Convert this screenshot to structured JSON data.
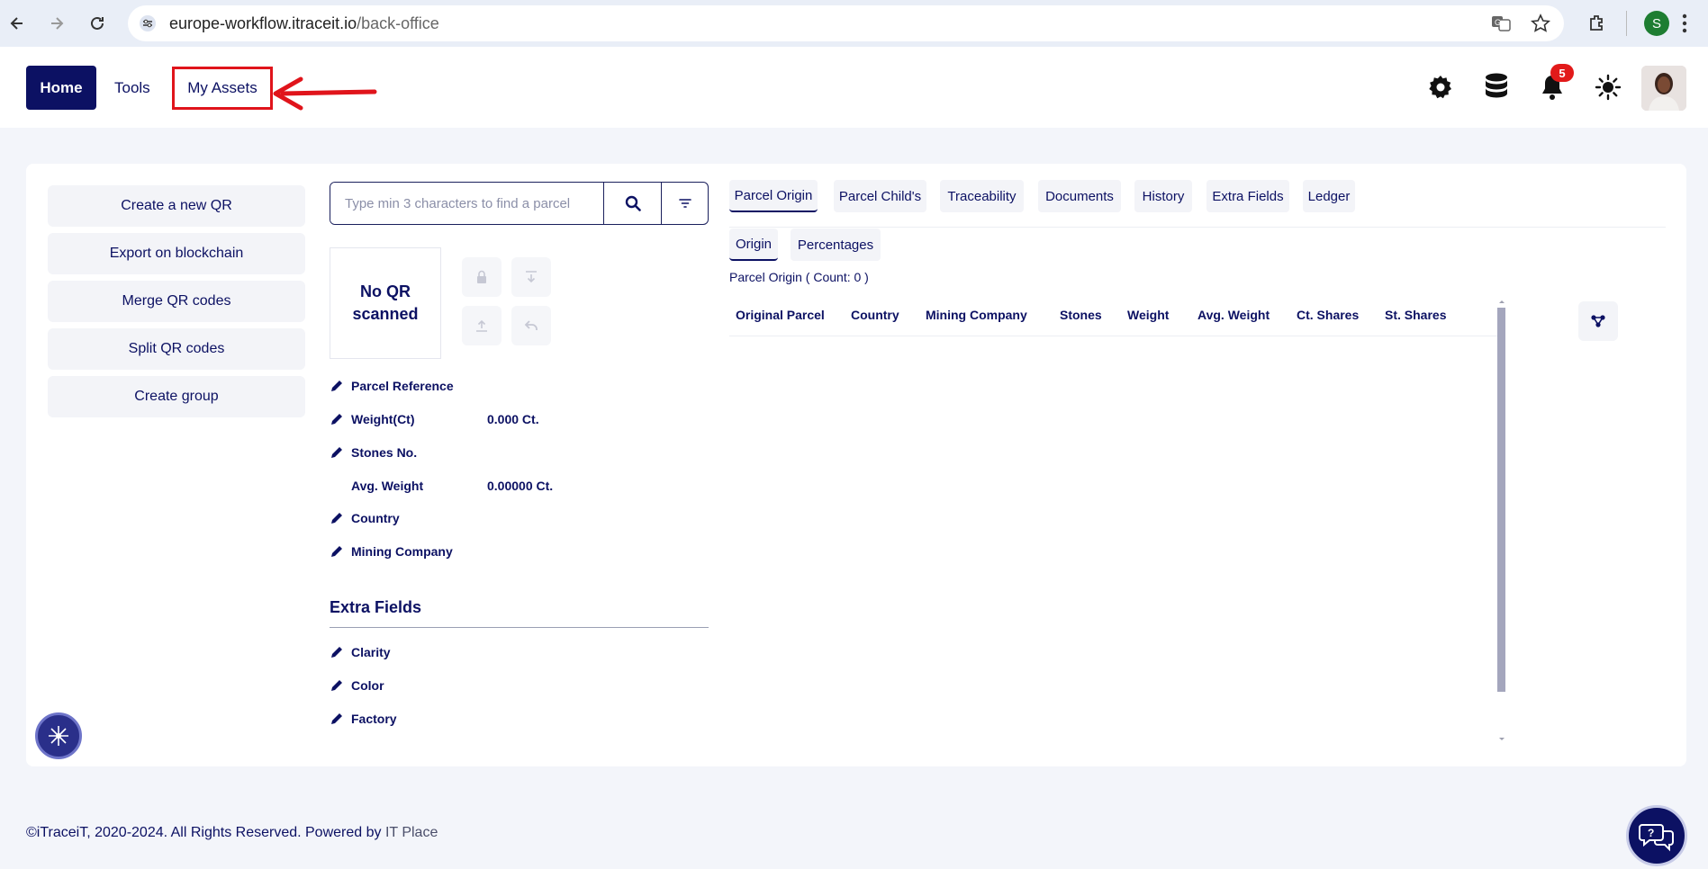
{
  "browser": {
    "url_host": "europe-workflow.itraceit.io",
    "url_path": "/back-office",
    "profile_initial": "S"
  },
  "header": {
    "nav": {
      "home": "Home",
      "tools": "Tools",
      "my_assets": "My Assets"
    },
    "notification_count": "5",
    "icons": [
      "gear-icon",
      "database-icon",
      "bell-icon",
      "sun-icon"
    ]
  },
  "sidebar": {
    "actions": [
      "Create a new QR",
      "Export on blockchain",
      "Merge QR codes",
      "Split QR codes",
      "Create group"
    ]
  },
  "search": {
    "placeholder": "Type min 3 characters to find a parcel"
  },
  "qr": {
    "status_line1": "No QR",
    "status_line2": "scanned"
  },
  "fields": {
    "parcel_reference": {
      "label": "Parcel Reference",
      "value": ""
    },
    "weight": {
      "label": "Weight(Ct)",
      "value": "0.000 Ct."
    },
    "stones": {
      "label": "Stones No.",
      "value": ""
    },
    "avg_weight": {
      "label": "Avg. Weight",
      "value": "0.00000 Ct."
    },
    "country": {
      "label": "Country",
      "value": ""
    },
    "mining_company": {
      "label": "Mining Company",
      "value": ""
    }
  },
  "extra_fields": {
    "title": "Extra Fields",
    "items": [
      "Clarity",
      "Color",
      "Factory"
    ]
  },
  "tabs": [
    "Parcel Origin",
    "Parcel Child's",
    "Traceability",
    "Documents",
    "History",
    "Extra Fields",
    "Ledger"
  ],
  "subtabs": [
    "Origin",
    "Percentages"
  ],
  "origin_table": {
    "count_label": "Parcel Origin ( Count: 0 )",
    "columns": [
      "Original Parcel",
      "Country",
      "Mining Company",
      "Stones",
      "Weight",
      "Avg. Weight",
      "Ct. Shares",
      "St. Shares"
    ]
  },
  "footer": {
    "text": "©iTraceiT, 2020-2024. All Rights Reserved. Powered by",
    "brand": "IT Place"
  }
}
